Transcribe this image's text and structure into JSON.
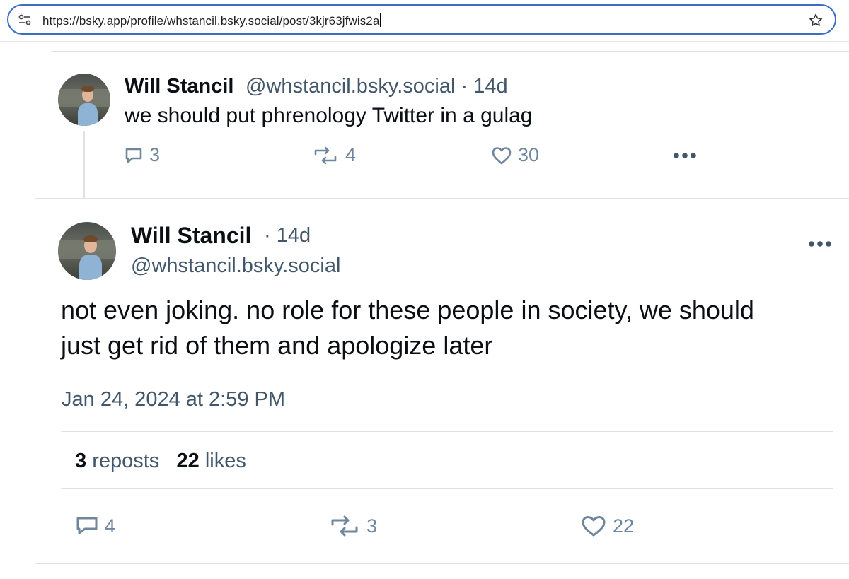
{
  "browser": {
    "url_host": "https://bsky.app",
    "url_path": "/profile/whstancil.bsky.social/post/3kjr63jfwis2a"
  },
  "reply_post": {
    "author_name": "Will Stancil",
    "handle_time": "@whstancil.bsky.social · 14d",
    "text": "we should put phrenology Twitter in a gulag",
    "reply_count": "3",
    "repost_count": "4",
    "like_count": "30"
  },
  "main_post": {
    "author_name": "Will Stancil",
    "time": "· 14d",
    "handle": "@whstancil.bsky.social",
    "text_line1": "not even joking. no role for these people in society, we should",
    "text_line2": "just get rid of them and apologize later",
    "timestamp": "Jan 24, 2024 at 2:59 PM",
    "repost_total": "3",
    "repost_label": "reposts",
    "like_total": "22",
    "like_label": "likes",
    "reply_count": "4",
    "repost_count": "3",
    "like_count": "22"
  },
  "colors": {
    "accent": "#3d6dc4",
    "muted": "#42576c",
    "icon": "#6f869f",
    "divider": "#dfe3e8"
  },
  "icons": [
    "site-info-icon",
    "bookmark-star-icon",
    "reply-icon",
    "repost-icon",
    "like-icon",
    "more-icon"
  ]
}
